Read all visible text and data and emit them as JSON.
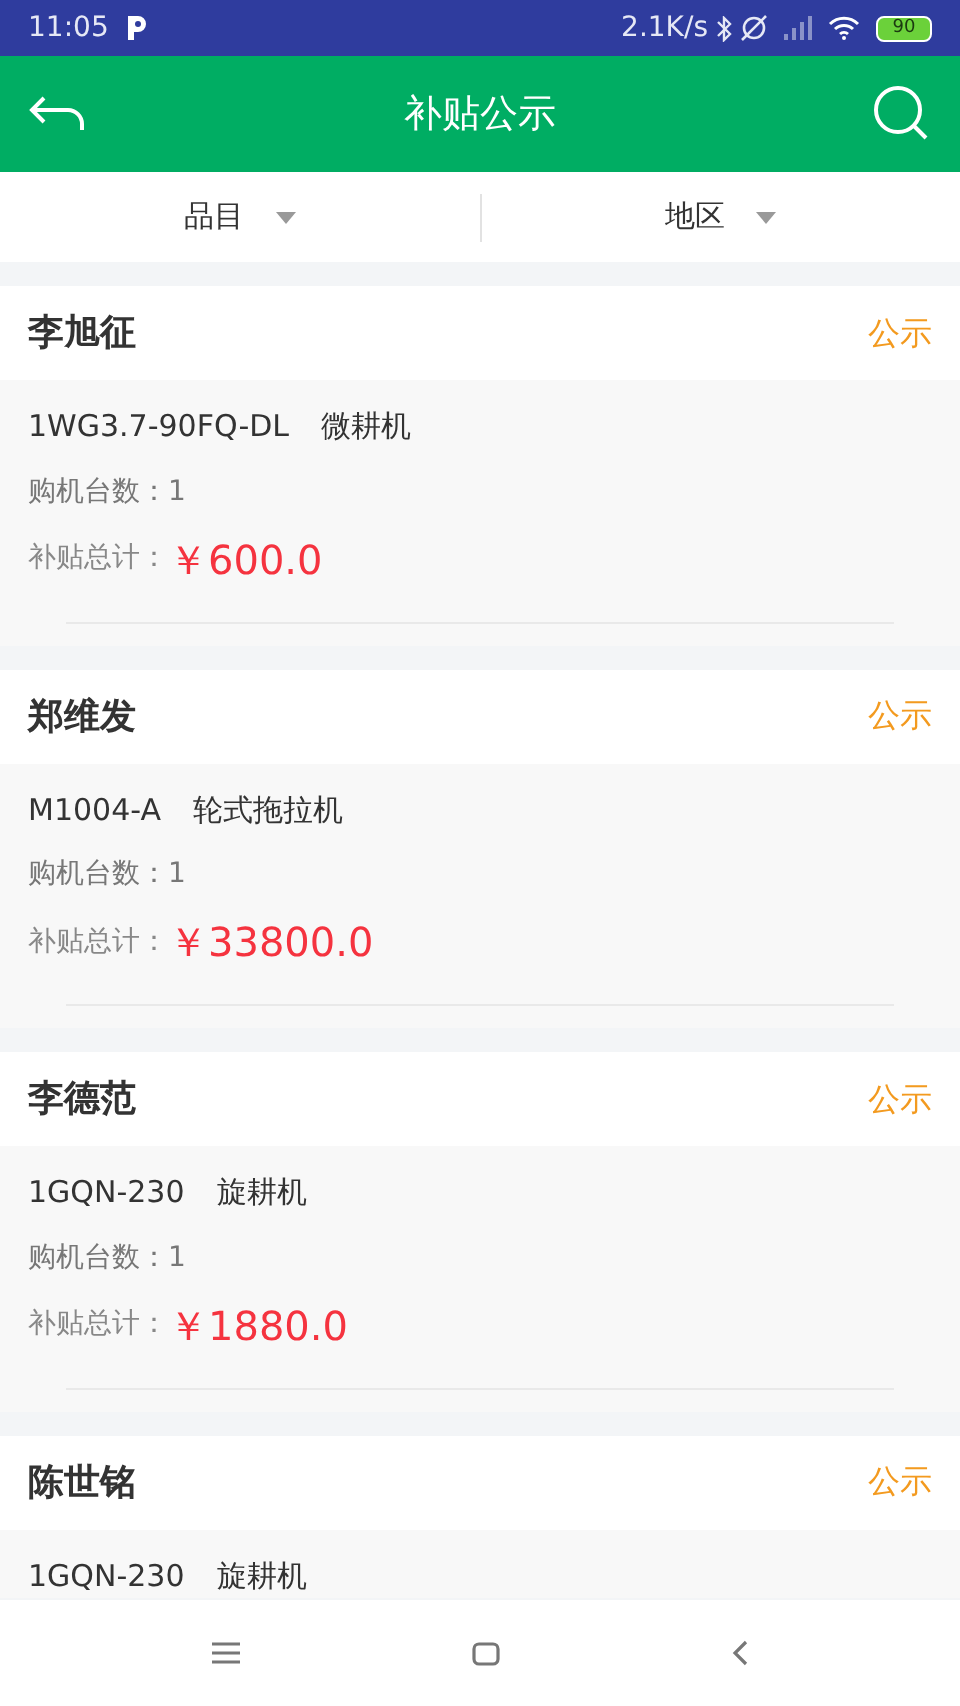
{
  "status_bar": {
    "time": "11:05",
    "speed": "2.1K/s",
    "battery": "90"
  },
  "header": {
    "title": "补贴公示"
  },
  "filters": [
    {
      "label": "品目"
    },
    {
      "label": "地区"
    }
  ],
  "records": [
    {
      "name": "李旭征",
      "tag": "公示",
      "model": "1WG3.7-90FQ-DL",
      "machine": "微耕机",
      "count": "购机台数：1",
      "total_label": "补贴总计：",
      "total": "￥600.0"
    },
    {
      "name": "郑维发",
      "tag": "公示",
      "model": "M1004-A",
      "machine": "轮式拖拉机",
      "count": "购机台数：1",
      "total_label": "补贴总计：",
      "total": "￥33800.0"
    },
    {
      "name": "李德范",
      "tag": "公示",
      "model": "1GQN-230",
      "machine": "旋耕机",
      "count": "购机台数：1",
      "total_label": "补贴总计：",
      "total": "￥1880.0"
    },
    {
      "name": "陈世铭",
      "tag": "公示",
      "model": "1GQN-230",
      "machine": "旋耕机"
    }
  ]
}
